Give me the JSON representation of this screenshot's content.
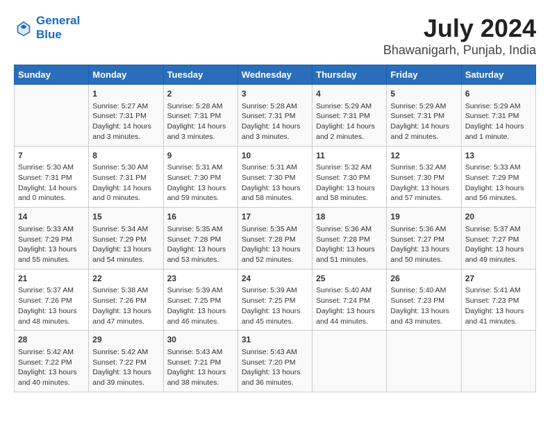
{
  "header": {
    "logo_line1": "General",
    "logo_line2": "Blue",
    "title": "July 2024",
    "subtitle": "Bhawanigarh, Punjab, India"
  },
  "calendar": {
    "days_of_week": [
      "Sunday",
      "Monday",
      "Tuesday",
      "Wednesday",
      "Thursday",
      "Friday",
      "Saturday"
    ],
    "weeks": [
      [
        {
          "day": "",
          "info": ""
        },
        {
          "day": "1",
          "info": "Sunrise: 5:27 AM\nSunset: 7:31 PM\nDaylight: 14 hours\nand 3 minutes."
        },
        {
          "day": "2",
          "info": "Sunrise: 5:28 AM\nSunset: 7:31 PM\nDaylight: 14 hours\nand 3 minutes."
        },
        {
          "day": "3",
          "info": "Sunrise: 5:28 AM\nSunset: 7:31 PM\nDaylight: 14 hours\nand 3 minutes."
        },
        {
          "day": "4",
          "info": "Sunrise: 5:29 AM\nSunset: 7:31 PM\nDaylight: 14 hours\nand 2 minutes."
        },
        {
          "day": "5",
          "info": "Sunrise: 5:29 AM\nSunset: 7:31 PM\nDaylight: 14 hours\nand 2 minutes."
        },
        {
          "day": "6",
          "info": "Sunrise: 5:29 AM\nSunset: 7:31 PM\nDaylight: 14 hours\nand 1 minute."
        }
      ],
      [
        {
          "day": "7",
          "info": "Sunrise: 5:30 AM\nSunset: 7:31 PM\nDaylight: 14 hours\nand 0 minutes."
        },
        {
          "day": "8",
          "info": "Sunrise: 5:30 AM\nSunset: 7:31 PM\nDaylight: 14 hours\nand 0 minutes."
        },
        {
          "day": "9",
          "info": "Sunrise: 5:31 AM\nSunset: 7:30 PM\nDaylight: 13 hours\nand 59 minutes."
        },
        {
          "day": "10",
          "info": "Sunrise: 5:31 AM\nSunset: 7:30 PM\nDaylight: 13 hours\nand 58 minutes."
        },
        {
          "day": "11",
          "info": "Sunrise: 5:32 AM\nSunset: 7:30 PM\nDaylight: 13 hours\nand 58 minutes."
        },
        {
          "day": "12",
          "info": "Sunrise: 5:32 AM\nSunset: 7:30 PM\nDaylight: 13 hours\nand 57 minutes."
        },
        {
          "day": "13",
          "info": "Sunrise: 5:33 AM\nSunset: 7:29 PM\nDaylight: 13 hours\nand 56 minutes."
        }
      ],
      [
        {
          "day": "14",
          "info": "Sunrise: 5:33 AM\nSunset: 7:29 PM\nDaylight: 13 hours\nand 55 minutes."
        },
        {
          "day": "15",
          "info": "Sunrise: 5:34 AM\nSunset: 7:29 PM\nDaylight: 13 hours\nand 54 minutes."
        },
        {
          "day": "16",
          "info": "Sunrise: 5:35 AM\nSunset: 7:28 PM\nDaylight: 13 hours\nand 53 minutes."
        },
        {
          "day": "17",
          "info": "Sunrise: 5:35 AM\nSunset: 7:28 PM\nDaylight: 13 hours\nand 52 minutes."
        },
        {
          "day": "18",
          "info": "Sunrise: 5:36 AM\nSunset: 7:28 PM\nDaylight: 13 hours\nand 51 minutes."
        },
        {
          "day": "19",
          "info": "Sunrise: 5:36 AM\nSunset: 7:27 PM\nDaylight: 13 hours\nand 50 minutes."
        },
        {
          "day": "20",
          "info": "Sunrise: 5:37 AM\nSunset: 7:27 PM\nDaylight: 13 hours\nand 49 minutes."
        }
      ],
      [
        {
          "day": "21",
          "info": "Sunrise: 5:37 AM\nSunset: 7:26 PM\nDaylight: 13 hours\nand 48 minutes."
        },
        {
          "day": "22",
          "info": "Sunrise: 5:38 AM\nSunset: 7:26 PM\nDaylight: 13 hours\nand 47 minutes."
        },
        {
          "day": "23",
          "info": "Sunrise: 5:39 AM\nSunset: 7:25 PM\nDaylight: 13 hours\nand 46 minutes."
        },
        {
          "day": "24",
          "info": "Sunrise: 5:39 AM\nSunset: 7:25 PM\nDaylight: 13 hours\nand 45 minutes."
        },
        {
          "day": "25",
          "info": "Sunrise: 5:40 AM\nSunset: 7:24 PM\nDaylight: 13 hours\nand 44 minutes."
        },
        {
          "day": "26",
          "info": "Sunrise: 5:40 AM\nSunset: 7:23 PM\nDaylight: 13 hours\nand 43 minutes."
        },
        {
          "day": "27",
          "info": "Sunrise: 5:41 AM\nSunset: 7:23 PM\nDaylight: 13 hours\nand 41 minutes."
        }
      ],
      [
        {
          "day": "28",
          "info": "Sunrise: 5:42 AM\nSunset: 7:22 PM\nDaylight: 13 hours\nand 40 minutes."
        },
        {
          "day": "29",
          "info": "Sunrise: 5:42 AM\nSunset: 7:22 PM\nDaylight: 13 hours\nand 39 minutes."
        },
        {
          "day": "30",
          "info": "Sunrise: 5:43 AM\nSunset: 7:21 PM\nDaylight: 13 hours\nand 38 minutes."
        },
        {
          "day": "31",
          "info": "Sunrise: 5:43 AM\nSunset: 7:20 PM\nDaylight: 13 hours\nand 36 minutes."
        },
        {
          "day": "",
          "info": ""
        },
        {
          "day": "",
          "info": ""
        },
        {
          "day": "",
          "info": ""
        }
      ]
    ]
  }
}
